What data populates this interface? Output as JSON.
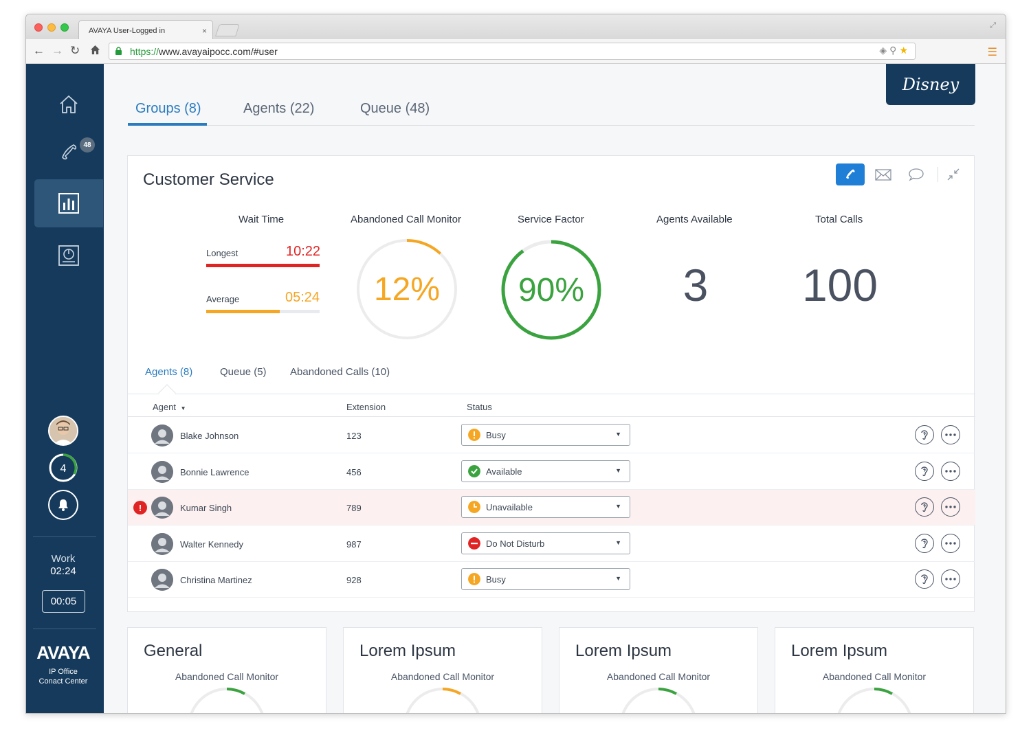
{
  "browser": {
    "tab_title": "AVAYA User-Logged in",
    "tab_close": "×",
    "url_scheme": "https://",
    "url_rest": "www.avayaipocc.com/#user"
  },
  "sidebar": {
    "phone_badge": "48",
    "ring_count": "4",
    "work_label": "Work",
    "work_time": "02:24",
    "timer": "00:05",
    "logo": "AVAYA",
    "sub_line1": "IP Office",
    "sub_line2": "Conact Center"
  },
  "brand": "Disney",
  "top_tabs": [
    {
      "label": "Groups (8)",
      "active": true
    },
    {
      "label": "Agents (22)",
      "active": false
    },
    {
      "label": "Queue (48)",
      "active": false
    }
  ],
  "card": {
    "title": "Customer Service",
    "metrics": {
      "wait_time_label": "Wait Time",
      "longest_label": "Longest",
      "longest_value": "10:22",
      "average_label": "Average",
      "average_value": "05:24",
      "average_fraction": 0.65,
      "abandoned_label": "Abandoned Call Monitor",
      "abandoned_value": "12%",
      "abandoned_fraction": 0.12,
      "service_label": "Service Factor",
      "service_value": "90%",
      "service_fraction": 0.9,
      "agents_available_label": "Agents Available",
      "agents_available_value": "3",
      "total_calls_label": "Total Calls",
      "total_calls_value": "100"
    },
    "sub_tabs": [
      {
        "label": "Agents (8)",
        "active": true
      },
      {
        "label": "Queue (5)",
        "active": false
      },
      {
        "label": "Abandoned Calls (10)",
        "active": false
      }
    ],
    "columns": {
      "agent": "Agent",
      "agent_sort": "▼",
      "extension": "Extension",
      "status": "Status"
    },
    "rows": [
      {
        "name": "Blake Johnson",
        "ext": "123",
        "status": "Busy",
        "status_color": "#f5a623",
        "alert": false
      },
      {
        "name": "Bonnie Lawrence",
        "ext": "456",
        "status": "Available",
        "status_color": "#3aa33f",
        "alert": false
      },
      {
        "name": "Kumar Singh",
        "ext": "789",
        "status": "Unavailable",
        "status_color": "#f5a623",
        "alert": true
      },
      {
        "name": "Walter Kennedy",
        "ext": "987",
        "status": "Do Not Disturb",
        "status_color": "#e02424",
        "alert": false
      },
      {
        "name": "Christina Martinez",
        "ext": "928",
        "status": "Busy",
        "status_color": "#f5a623",
        "alert": false
      }
    ],
    "alert_symbol": "!"
  },
  "mini_cards": [
    {
      "title": "General",
      "label": "Abandoned Call Monitor",
      "color": "#3aa33f"
    },
    {
      "title": "Lorem Ipsum",
      "label": "Abandoned Call Monitor",
      "color": "#f5a623"
    },
    {
      "title": "Lorem Ipsum",
      "label": "Abandoned Call Monitor",
      "color": "#3aa33f"
    },
    {
      "title": "Lorem Ipsum",
      "label": "Abandoned Call Monitor",
      "color": "#3aa33f"
    }
  ],
  "colors": {
    "navy": "#163a5c",
    "accent_blue": "#2a7bbf",
    "red": "#e02424",
    "orange": "#f5a623",
    "green": "#3aa33f"
  },
  "icons": [
    "home-icon",
    "phone-icon",
    "bar-chart-icon",
    "pie-report-icon",
    "bell-icon",
    "phone-tool-icon",
    "mail-icon",
    "chat-icon",
    "collapse-icon",
    "listen-icon",
    "more-icon",
    "lock-icon",
    "star-icon"
  ]
}
